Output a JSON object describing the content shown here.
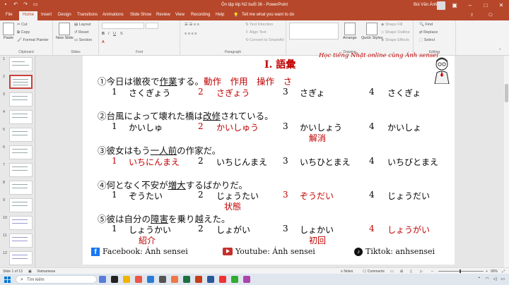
{
  "app": {
    "title": "Ôn tập klp N2 buổi 36 - PowerPoint",
    "user": "Bùi Văn Ánh",
    "window_controls": [
      "minimize-icon",
      "restore-icon",
      "close-icon"
    ]
  },
  "tabs": [
    "File",
    "Home",
    "Insert",
    "Design",
    "Transitions",
    "Animations",
    "Slide Show",
    "Review",
    "View",
    "Recording",
    "Help"
  ],
  "active_tab": "Home",
  "tell_me": "Tell me what you want to do",
  "ribbon": {
    "clipboard": {
      "paste": "Paste",
      "cut": "Cut",
      "copy": "Copy",
      "format_painter": "Format Painter",
      "label": "Clipboard"
    },
    "slides": {
      "new_slide": "New Slide",
      "layout": "Layout",
      "reset": "Reset",
      "section": "Section",
      "label": "Slides"
    },
    "font": {
      "label": "Font"
    },
    "paragraph": {
      "text_direction": "Text Direction",
      "align_text": "Align Text",
      "convert": "Convert to SmartArt",
      "label": "Paragraph"
    },
    "drawing": {
      "arrange": "Arrange",
      "quick_styles": "Quick Styles",
      "shape_fill": "Shape Fill",
      "shape_outline": "Shape Outline",
      "shape_effects": "Shape Effects",
      "label": "Drawing"
    },
    "editing": {
      "find": "Find",
      "replace": "Replace",
      "select": "Select",
      "label": "Editing"
    }
  },
  "thumbnails": [
    "1",
    "2",
    "3",
    "4",
    "5",
    "6",
    "7",
    "8",
    "9",
    "10",
    "11",
    "12",
    "13"
  ],
  "selected_slide": "2",
  "slide": {
    "heading": "I. 語彙",
    "promo": "Học tiếng Nhật online cùng Ánh sensei",
    "questions": [
      {
        "num": "①",
        "pre": "今日は徹夜で",
        "target": "作業",
        "post": "する。",
        "extra": "動作　作用　操作　さ",
        "options": [
          {
            "n": "1",
            "t": "さくぎょう"
          },
          {
            "n": "2",
            "t": "さぎょう"
          },
          {
            "n": "3",
            "t": "さぎょ"
          },
          {
            "n": "4",
            "t": "さくぎょ"
          }
        ],
        "answer": "2",
        "note": ""
      },
      {
        "num": "②",
        "pre": "台風によって壊れた橋は",
        "target": "改修",
        "post": "されている。",
        "extra": "",
        "options": [
          {
            "n": "1",
            "t": "かいしゅ"
          },
          {
            "n": "2",
            "t": "かいしゅう"
          },
          {
            "n": "3",
            "t": "かいしょう"
          },
          {
            "n": "4",
            "t": "かいしょ"
          }
        ],
        "answer": "2",
        "note": "解消"
      },
      {
        "num": "③",
        "pre": "彼女はもう",
        "target": "一人前",
        "post": "の作家だ。",
        "extra": "",
        "options": [
          {
            "n": "1",
            "t": "いちにんまえ"
          },
          {
            "n": "2",
            "t": "いちじんまえ"
          },
          {
            "n": "3",
            "t": "いちひとまえ"
          },
          {
            "n": "4",
            "t": "いちびとまえ"
          }
        ],
        "answer": "1",
        "note": ""
      },
      {
        "num": "④",
        "pre": "何となく不安が",
        "target": "増大",
        "post": "するばかりだ。",
        "extra": "",
        "options": [
          {
            "n": "1",
            "t": "ぞうたい"
          },
          {
            "n": "2",
            "t": "じょうたい"
          },
          {
            "n": "3",
            "t": "ぞうだい"
          },
          {
            "n": "4",
            "t": "じょうだい"
          }
        ],
        "answer": "3",
        "note": "状態"
      },
      {
        "num": "⑤",
        "pre": "彼は自分の",
        "target": "障害",
        "post": "を乗り越えた。",
        "extra": "",
        "options": [
          {
            "n": "1",
            "t": "しょうかい"
          },
          {
            "n": "2",
            "t": "しょがい"
          },
          {
            "n": "3",
            "t": "しょかい"
          },
          {
            "n": "4",
            "t": "しょうがい"
          }
        ],
        "answer": "4",
        "notes": [
          "紹介",
          "初回"
        ]
      }
    ],
    "footer": {
      "facebook": "Facebook: Ánh sensei",
      "youtube": "Youtube: Ánh sensei",
      "tiktok": "Tiktok: anhsensei"
    }
  },
  "status": {
    "slide_info": "Slide 1 of 13",
    "language": "Vietnamese",
    "notes": "Notes",
    "comments": "Comments",
    "zoom": "90%"
  },
  "taskbar": {
    "search_placeholder": "Tìm kiếm"
  },
  "colors": {
    "accent": "#b7472a",
    "answer_red": "#c00000"
  }
}
